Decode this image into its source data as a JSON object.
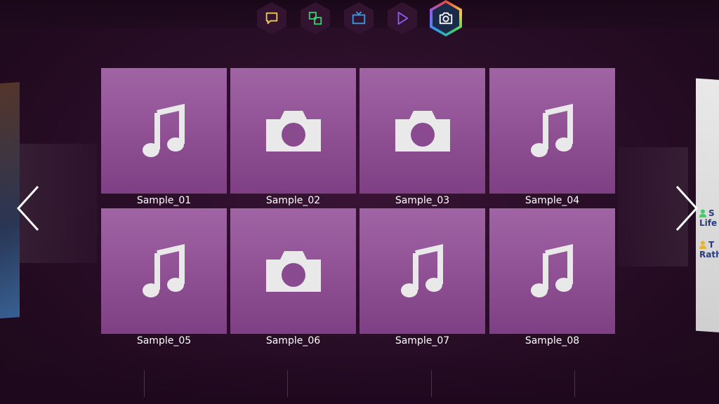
{
  "nav": {
    "items": [
      {
        "icon": "chat-bubble-icon",
        "color": "#f2c94c"
      },
      {
        "icon": "apps-icon",
        "color": "#3ad06b"
      },
      {
        "icon": "tv-icon",
        "color": "#2f9ee8"
      },
      {
        "icon": "play-icon",
        "color": "#8b5cf6"
      },
      {
        "icon": "camera-icon",
        "color": "#ffffff",
        "active": true
      }
    ]
  },
  "tiles": [
    {
      "label": "Sample_01",
      "type": "music"
    },
    {
      "label": "Sample_02",
      "type": "photo"
    },
    {
      "label": "Sample_03",
      "type": "photo"
    },
    {
      "label": "Sample_04",
      "type": "music"
    },
    {
      "label": "Sample_05",
      "type": "music"
    },
    {
      "label": "Sample_06",
      "type": "photo"
    },
    {
      "label": "Sample_07",
      "type": "music"
    },
    {
      "label": "Sample_08",
      "type": "music"
    }
  ],
  "right_peek": {
    "row1": {
      "title": "S",
      "subtitle": "Life"
    },
    "row2": {
      "title": "T",
      "subtitle": "Rath"
    }
  },
  "colors": {
    "tile_top": "#a064a4",
    "tile_bottom": "#7f3f84",
    "peek_text": "#2b3a7a",
    "peek_user": "#3ad06b"
  }
}
